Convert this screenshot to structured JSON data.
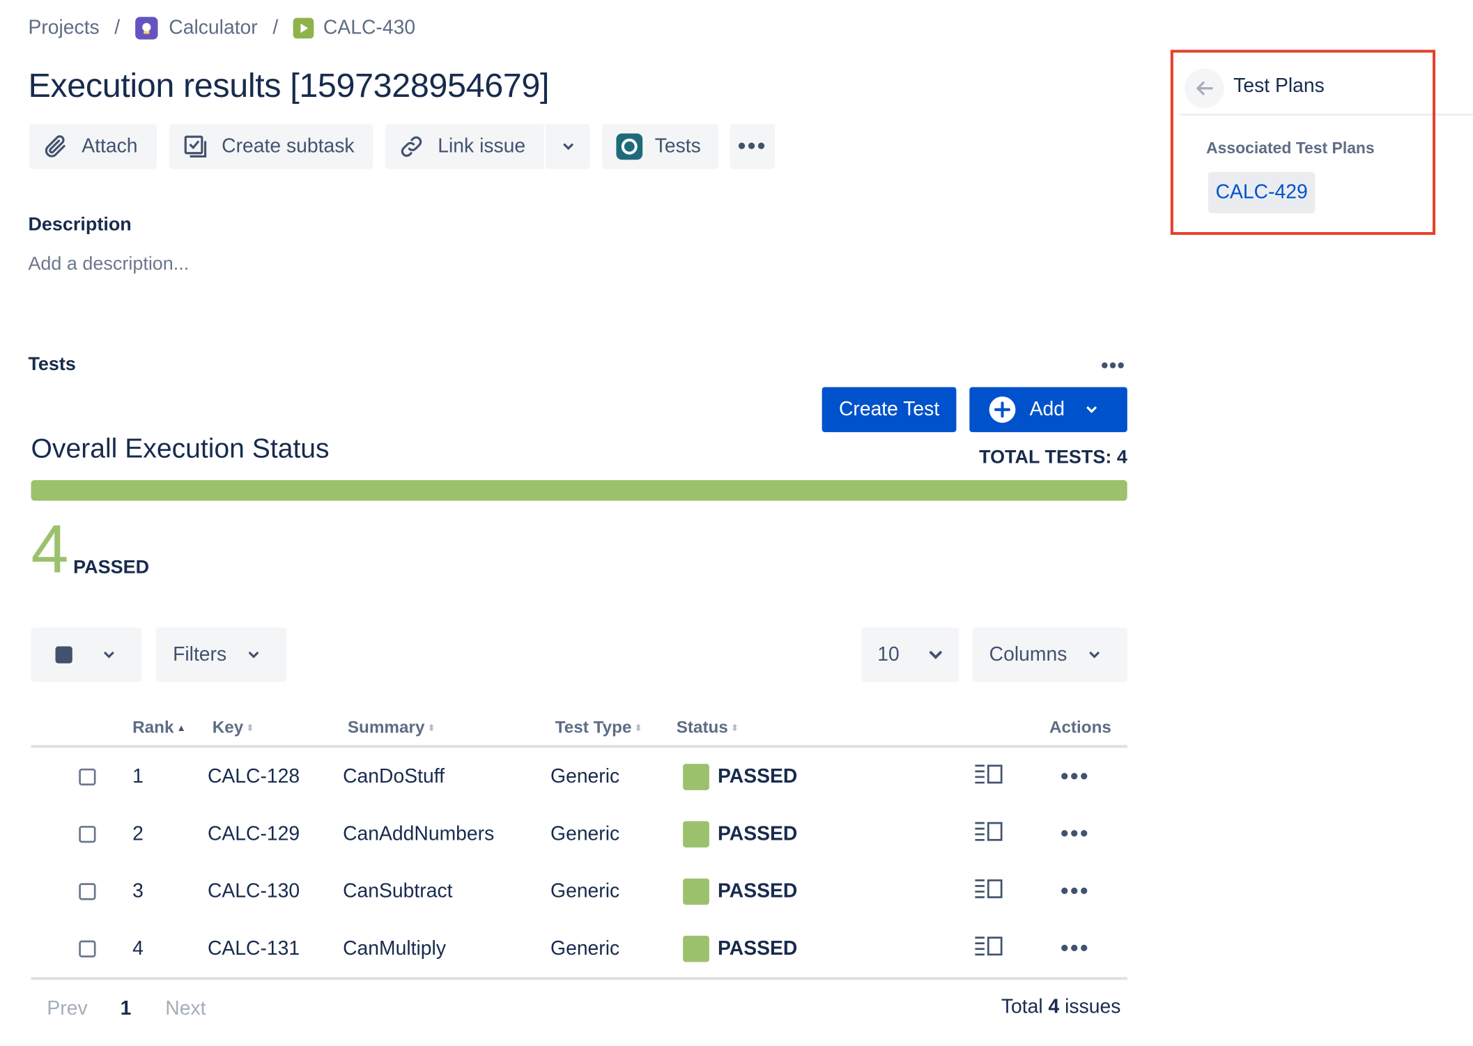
{
  "breadcrumb": {
    "items": [
      "Projects",
      "Calculator",
      "CALC-430"
    ],
    "separator": "/"
  },
  "title": "Execution results [1597328954679]",
  "toolbar": {
    "attach": "Attach",
    "create_subtask": "Create subtask",
    "link_issue": "Link issue",
    "tests": "Tests"
  },
  "description": {
    "label": "Description",
    "placeholder": "Add a description..."
  },
  "tests_section": {
    "label": "Tests",
    "create_test": "Create Test",
    "add": "Add"
  },
  "overall": {
    "title": "Overall Execution Status",
    "total_tests": "TOTAL TESTS: 4",
    "passed_count": "4",
    "passed_label": "PASSED",
    "passed_fraction": 1.0,
    "colors": {
      "passed": "#9cc16c",
      "track": "#dfe1e6"
    }
  },
  "controls": {
    "filters": "Filters",
    "page_size": "10",
    "columns": "Columns"
  },
  "table": {
    "headers": {
      "rank": "Rank",
      "key": "Key",
      "summary": "Summary",
      "test_type": "Test Type",
      "status": "Status",
      "actions": "Actions"
    },
    "rows": [
      {
        "rank": "1",
        "key": "CALC-128",
        "summary": "CanDoStuff",
        "type": "Generic",
        "status": "PASSED"
      },
      {
        "rank": "2",
        "key": "CALC-129",
        "summary": "CanAddNumbers",
        "type": "Generic",
        "status": "PASSED"
      },
      {
        "rank": "3",
        "key": "CALC-130",
        "summary": "CanSubtract",
        "type": "Generic",
        "status": "PASSED"
      },
      {
        "rank": "4",
        "key": "CALC-131",
        "summary": "CanMultiply",
        "type": "Generic",
        "status": "PASSED"
      }
    ]
  },
  "pager": {
    "prev": "Prev",
    "page": "1",
    "next": "Next",
    "total_prefix": "Total",
    "total_count": "4",
    "total_suffix": "issues"
  },
  "side_panel": {
    "title": "Test Plans",
    "subtitle": "Associated Test Plans",
    "plan_key": "CALC-429",
    "highlight_color": "#e5412d"
  },
  "accent_color": "#0052cc"
}
